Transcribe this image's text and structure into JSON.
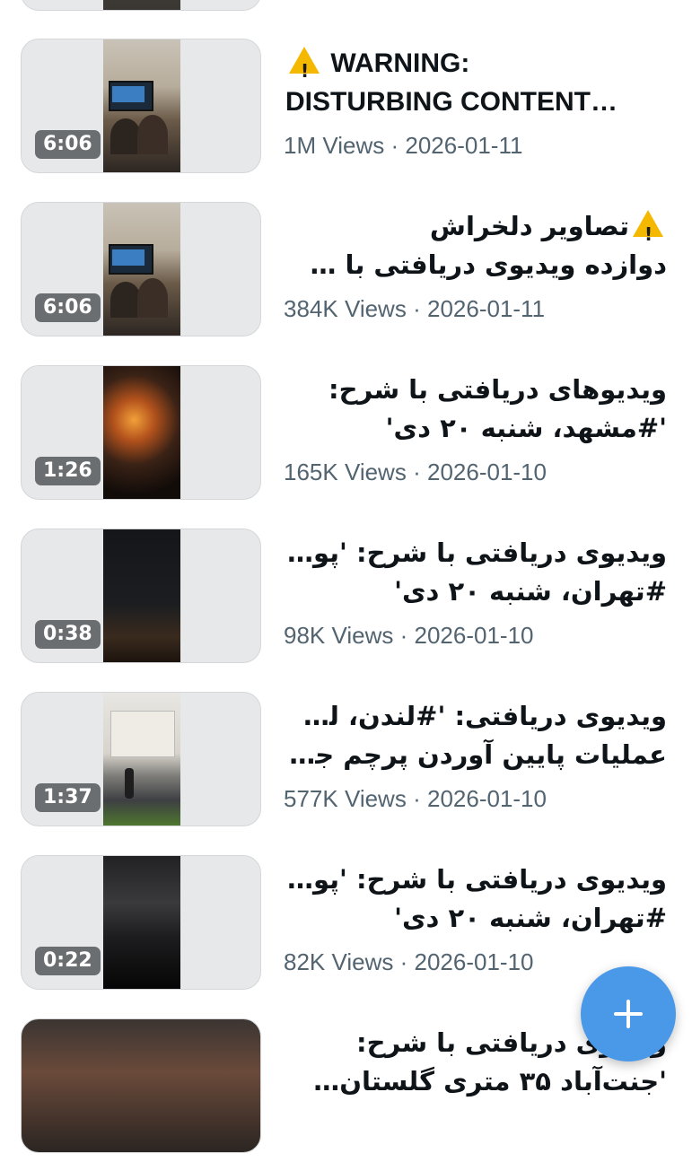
{
  "feed": {
    "items": [
      {
        "duration": "",
        "title_lines": [
          "",
          ""
        ],
        "views": "",
        "date": ""
      },
      {
        "duration": "6:06",
        "title_lines": [
          "WARNING:",
          "DISTURBING CONTENT…"
        ],
        "warning_icon": "warning-icon",
        "views": "1M Views",
        "date": "2026-01-11"
      },
      {
        "duration": "6:06",
        "title_lines": [
          "تصاویر دلخراش",
          "دوازده ویدیوی دریافتی با شر…"
        ],
        "warning_icon": "warning-icon",
        "views": "384K Views",
        "date": "2026-01-11"
      },
      {
        "duration": "1:26",
        "title_lines": [
          "ویدیوهای دریافتی با شرح:",
          "'#مشهد، شنبه ۲۰ دی'"
        ],
        "views": "165K Views",
        "date": "2026-01-10"
      },
      {
        "duration": "0:38",
        "title_lines": [
          "ویدیوی دریافتی با شرح: 'پونک",
          "#تهران، شنبه ۲۰ دی'"
        ],
        "views": "98K Views",
        "date": "2026-01-10"
      },
      {
        "duration": "1:37",
        "title_lines": [
          "ویدیوی دریافتی: '#لندن، لحظه",
          "عملیات پایین آوردن پرچم جم…"
        ],
        "views": "577K Views",
        "date": "2026-01-10"
      },
      {
        "duration": "0:22",
        "title_lines": [
          "ویدیوی دریافتی با شرح: 'پونک",
          "#تهران، شنبه ۲۰ دی'"
        ],
        "views": "82K Views",
        "date": "2026-01-10"
      },
      {
        "duration": "",
        "title_lines": [
          "ویدیوی دریافتی با شرح:",
          "'جنت‌آباد ۳۵ متری گلستان…"
        ],
        "views": "",
        "date": ""
      }
    ],
    "separator": "·"
  },
  "fab": {
    "icon": "plus-icon",
    "color": "#4a99e9"
  },
  "colors": {
    "title": "#0f1419",
    "meta": "#536471",
    "thumb_bg": "#e7e8ea",
    "warning": "#f5b800"
  }
}
